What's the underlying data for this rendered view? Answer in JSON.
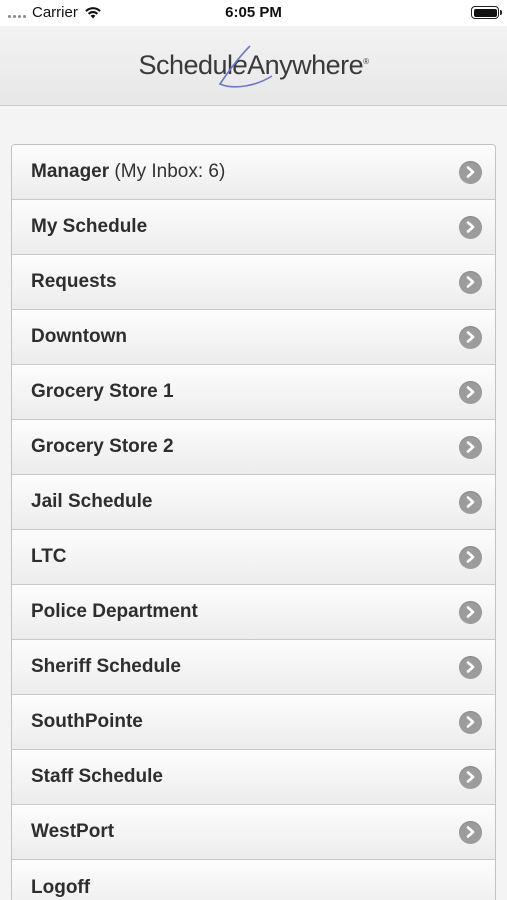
{
  "status_bar": {
    "carrier": "Carrier",
    "time": "6:05 PM",
    "wifi_icon": "wifi-icon",
    "battery_icon": "battery-icon"
  },
  "header": {
    "logo_part1": "Schedul",
    "logo_part2": "e",
    "logo_part3": "Anywhere",
    "logo_reg": "®"
  },
  "menu": {
    "arrow_icon": "chevron-right-circle-icon",
    "items": [
      {
        "label": "Manager",
        "extra": " (My Inbox: 6)"
      },
      {
        "label": "My Schedule"
      },
      {
        "label": "Requests"
      },
      {
        "label": "Downtown"
      },
      {
        "label": "Grocery Store 1"
      },
      {
        "label": "Grocery Store 2"
      },
      {
        "label": "Jail Schedule"
      },
      {
        "label": "LTC"
      },
      {
        "label": "Police Department"
      },
      {
        "label": "Sheriff Schedule"
      },
      {
        "label": "SouthPointe"
      },
      {
        "label": "Staff Schedule"
      },
      {
        "label": "WestPort"
      },
      {
        "label": "Logoff"
      }
    ]
  },
  "colors": {
    "header_bg": "#ececec",
    "item_text": "#2e2e2e",
    "arrow_bg": "#9c9c9c"
  }
}
